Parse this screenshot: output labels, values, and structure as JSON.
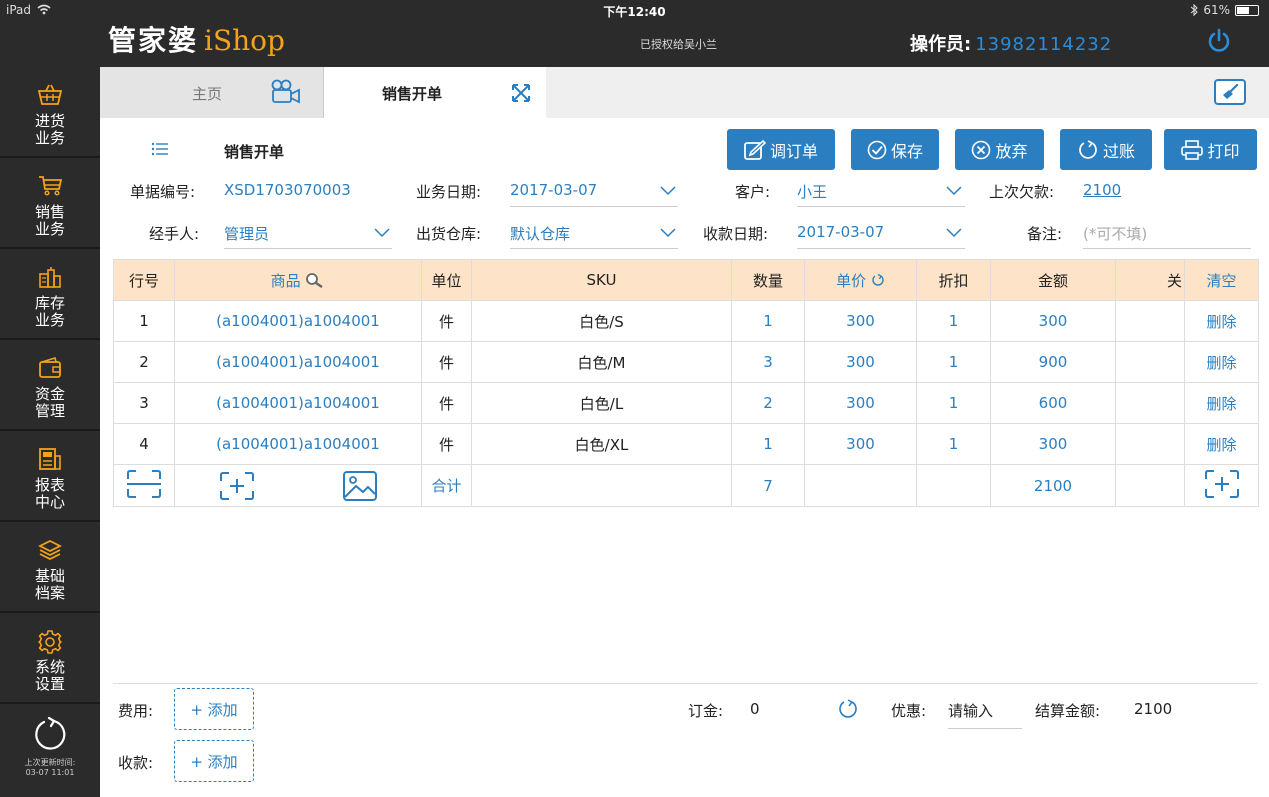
{
  "status": {
    "device": "iPad",
    "time": "下午12:40",
    "battery": "61%",
    "battery_level": 0.61
  },
  "header": {
    "brand_cn": "管家婆",
    "brand_en": "iShop",
    "authorized_to": "已授权给吴小兰",
    "operator_label": "操作员:",
    "operator_id": "13982114232"
  },
  "sidebar": {
    "items": [
      {
        "line1": "进货",
        "line2": "业务",
        "icon": "basket-icon"
      },
      {
        "line1": "销售",
        "line2": "业务",
        "icon": "cart-icon"
      },
      {
        "line1": "库存",
        "line2": "业务",
        "icon": "warehouse-icon"
      },
      {
        "line1": "资金",
        "line2": "管理",
        "icon": "wallet-icon"
      },
      {
        "line1": "报表",
        "line2": "中心",
        "icon": "report-icon"
      },
      {
        "line1": "基础",
        "line2": "档案",
        "icon": "layers-icon"
      },
      {
        "line1": "系统",
        "line2": "设置",
        "icon": "gear-icon"
      }
    ],
    "last_update_label": "上次更新时间:",
    "last_update_time": "03-07 11:01"
  },
  "tabs": {
    "home": "主页",
    "active": "销售开单"
  },
  "page": {
    "title": "销售开单"
  },
  "toolbar": {
    "adjust": "调订单",
    "save": "保存",
    "discard": "放弃",
    "post": "过账",
    "print": "打印"
  },
  "form": {
    "doc_no_label": "单据编号:",
    "doc_no": "XSD1703070003",
    "biz_date_label": "业务日期:",
    "biz_date": "2017-03-07",
    "customer_label": "客户:",
    "customer": "小王",
    "last_debt_label": "上次欠款:",
    "last_debt": "2100",
    "handler_label": "经手人:",
    "handler": "管理员",
    "warehouse_label": "出货仓库:",
    "warehouse": "默认仓库",
    "pay_date_label": "收款日期:",
    "pay_date": "2017-03-07",
    "remark_label": "备注:",
    "remark_placeholder": "(*可不填)"
  },
  "table": {
    "headers": {
      "row_no": "行号",
      "product": "商品",
      "unit": "单位",
      "sku": "SKU",
      "qty": "数量",
      "price": "单价",
      "discount": "折扣",
      "amount": "金额",
      "extra": "关",
      "clear": "清空"
    },
    "rows": [
      {
        "no": "1",
        "product": "(a1004001)a1004001",
        "unit": "件",
        "sku": "白色/S",
        "qty": "1",
        "price": "300",
        "discount": "1",
        "amount": "300",
        "action": "删除"
      },
      {
        "no": "2",
        "product": "(a1004001)a1004001",
        "unit": "件",
        "sku": "白色/M",
        "qty": "3",
        "price": "300",
        "discount": "1",
        "amount": "900",
        "action": "删除"
      },
      {
        "no": "3",
        "product": "(a1004001)a1004001",
        "unit": "件",
        "sku": "白色/L",
        "qty": "2",
        "price": "300",
        "discount": "1",
        "amount": "600",
        "action": "删除"
      },
      {
        "no": "4",
        "product": "(a1004001)a1004001",
        "unit": "件",
        "sku": "白色/XL",
        "qty": "1",
        "price": "300",
        "discount": "1",
        "amount": "300",
        "action": "删除"
      }
    ],
    "summary": {
      "label": "合计",
      "qty": "7",
      "amount": "2100"
    }
  },
  "footer": {
    "fee_label": "费用:",
    "fee_add": "+ 添加",
    "receive_label": "收款:",
    "receive_add": "+ 添加",
    "deposit_label": "订金:",
    "deposit": "0",
    "discount_label": "优惠:",
    "discount_placeholder": "请输入",
    "settle_label": "结算金额:",
    "settle": "2100"
  },
  "colors": {
    "accent": "#2b7fc1",
    "brand_orange": "#f4a21a",
    "header_bg": "#fde4c8",
    "dark": "#2b2b2b"
  }
}
